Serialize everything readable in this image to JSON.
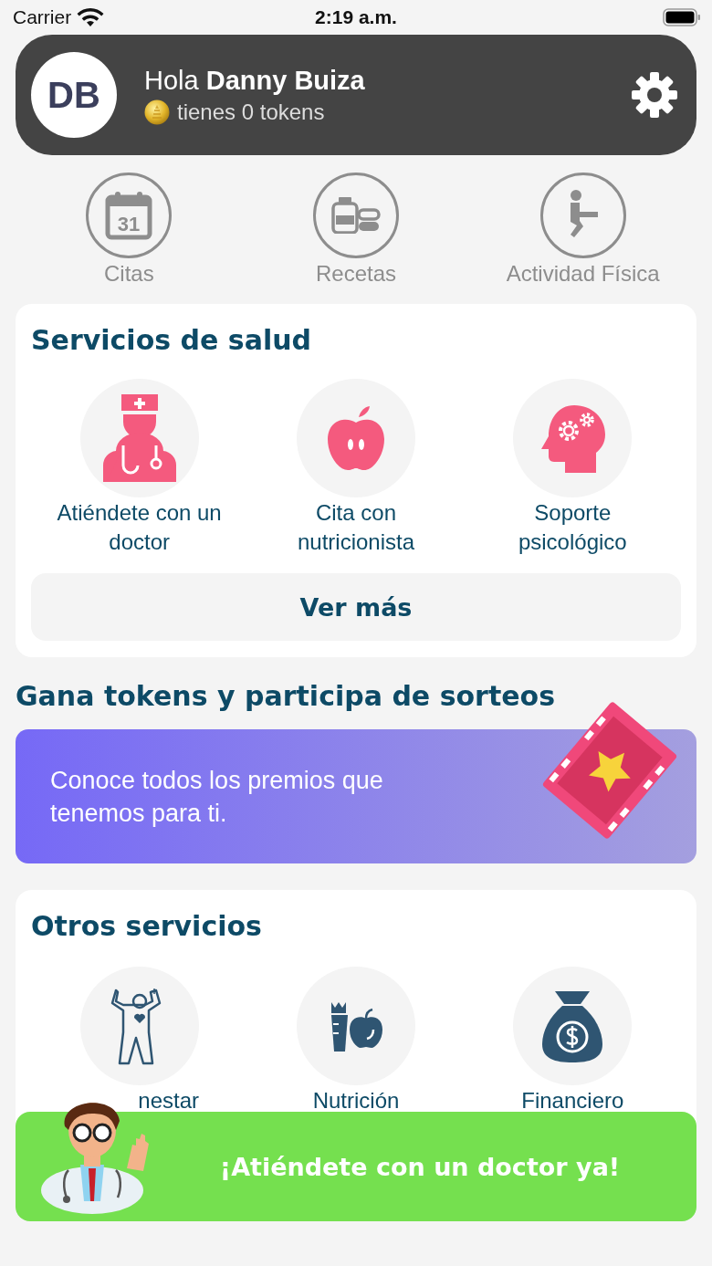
{
  "status_bar": {
    "carrier": "Carrier",
    "time": "2:19 a.m."
  },
  "header": {
    "initials": "DB",
    "greeting": "Hola **Danny Buiza**",
    "tokens": "tienes 0 tokens"
  },
  "shortcuts": [
    {
      "kind": "calendar",
      "label": "Citas",
      "icon_text": "31"
    },
    {
      "kind": "medicine",
      "label": "Recetas"
    },
    {
      "kind": "exercise",
      "label": "Actividad Física"
    }
  ],
  "health_services": {
    "title": "Servicios de salud",
    "items": [
      {
        "kind": "doctor",
        "label": "Atiéndete con un doctor"
      },
      {
        "kind": "apple",
        "label": "Cita con nutricionista"
      },
      {
        "kind": "mind",
        "label": "Soporte psicológico"
      }
    ],
    "more_button": "Ver más"
  },
  "rewards": {
    "title": "Gana tokens y participa de sorteos",
    "banner_text": "Conoce todos los premios que tenemos para ti."
  },
  "other_services": {
    "title": "Otros servicios",
    "items": [
      {
        "kind": "wellbeing",
        "label": "nestar"
      },
      {
        "kind": "nutrition",
        "label": "Nutrición"
      },
      {
        "kind": "money",
        "label": "Financiero"
      }
    ]
  },
  "cta": {
    "label": "¡Atiéndete con un doctor ya!"
  }
}
